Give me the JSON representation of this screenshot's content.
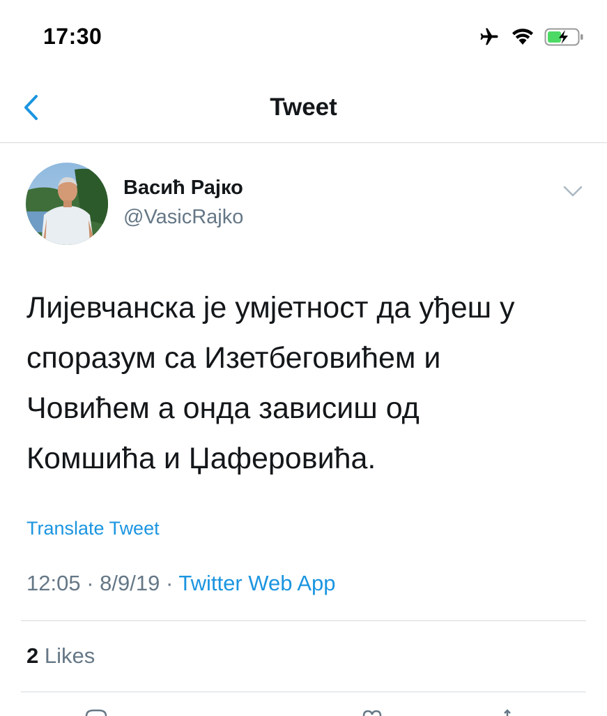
{
  "status_bar": {
    "time": "17:30",
    "icons": [
      "airplane-icon",
      "wifi-icon",
      "battery-charging-icon"
    ],
    "battery_color": "#4cd964"
  },
  "nav": {
    "title": "Tweet",
    "back_icon": "chevron-left-icon"
  },
  "tweet": {
    "author_name": "Васић Рајко",
    "author_handle": "@VasicRajko",
    "text_lines": [
      "Лијевчанска је умјетност да уђеш у",
      "споразум са Изетбеговићем и",
      "Човићем а онда зависиш од",
      "Комшића и Џаферовића."
    ],
    "translate_label": "Translate Tweet",
    "time": "12:05",
    "date": "8/9/19",
    "separator": "·",
    "source": "Twitter Web App",
    "likes_count": "2",
    "likes_label": "Likes"
  },
  "colors": {
    "accent": "#1b95e0",
    "muted": "#657786",
    "text": "#14171a",
    "divider": "#d6d9db"
  }
}
